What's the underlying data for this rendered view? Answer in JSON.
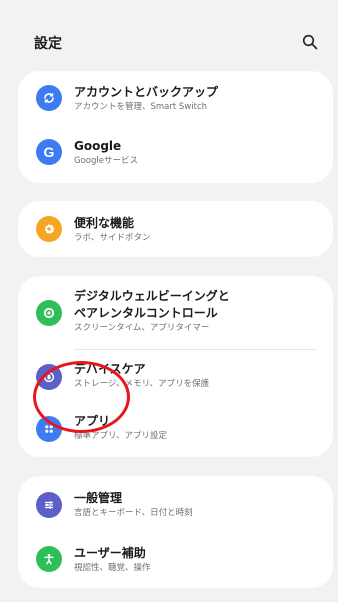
{
  "header": {
    "title": "設定",
    "search_icon": "search-icon"
  },
  "groups": [
    {
      "items": [
        {
          "label": "アカウントとバックアップ",
          "sub": "アカウントを管理、Smart Switch",
          "icon": "sync-icon",
          "color": "#3c7bf0"
        },
        {
          "label": "Google",
          "sub": "Googleサービス",
          "icon": "google-icon",
          "color": "#3c7bf0"
        }
      ]
    },
    {
      "items": [
        {
          "label": "便利な機能",
          "sub": "ラボ、サイドボタン",
          "icon": "gear-plus-icon",
          "color": "#f5a623"
        }
      ]
    },
    {
      "items": [
        {
          "label": "デジタルウェルビーイングと",
          "label2": "ペアレンタルコントロール",
          "sub": "スクリーンタイム、アプリタイマー",
          "icon": "wellbeing-icon",
          "color": "#2fbf5a"
        },
        {
          "label": "デバイスケア",
          "sub": "ストレージ、メモリ、アプリを保護",
          "icon": "device-care-icon",
          "color": "#5b5fc7"
        },
        {
          "label": "アプリ",
          "sub": "標準アプリ、アプリ設定",
          "icon": "apps-icon",
          "color": "#3c7bf0"
        }
      ]
    },
    {
      "items": [
        {
          "label": "一般管理",
          "sub": "言語とキーボード、日付と時刻",
          "icon": "sliders-icon",
          "color": "#5b5fc7"
        },
        {
          "label": "ユーザー補助",
          "sub": "視認性、聴覚、操作",
          "icon": "accessibility-icon",
          "color": "#2fbf5a"
        }
      ]
    }
  ],
  "highlight": {
    "target": "アプリ",
    "color": "#e8151d"
  }
}
